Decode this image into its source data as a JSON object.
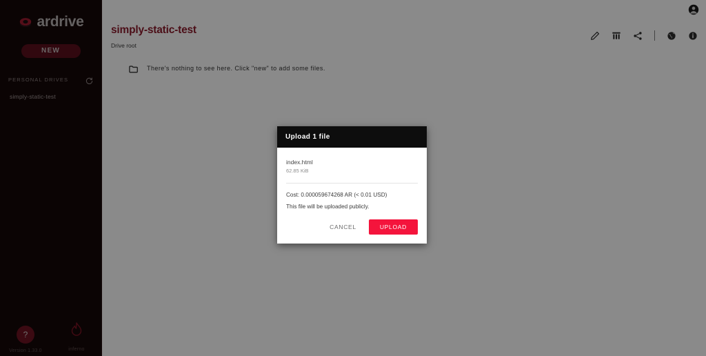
{
  "sidebar": {
    "logo_text": "ardrive",
    "new_button": "NEW",
    "drives_section_label": "PERSONAL DRIVES",
    "drives": [
      {
        "name": "simply-static-test"
      }
    ],
    "footer": {
      "help_glyph": "?",
      "version": "Version 1.33.0",
      "inferno_label": "inferno"
    }
  },
  "main": {
    "page_title": "simply-static-test",
    "breadcrumb": "Drive root",
    "empty_message": "There's nothing to see here. Click \"new\" to add some files.",
    "toolbar_icons": [
      {
        "name": "edit-icon"
      },
      {
        "name": "table-icon"
      },
      {
        "name": "share-icon"
      },
      {
        "name": "globe-icon"
      },
      {
        "name": "info-icon"
      }
    ]
  },
  "modal": {
    "title": "Upload 1 file",
    "file": {
      "name": "index.html",
      "size": "62.85 KiB"
    },
    "cost": "Cost: 0.000059674268 AR (< 0.01 USD)",
    "privacy_note": "This file will be uploaded publicly.",
    "cancel_label": "CANCEL",
    "upload_label": "UPLOAD"
  },
  "colors": {
    "brand_red": "#f4143c",
    "title_red": "#8c1c2d",
    "sidebar_bg": "#150808",
    "modal_header_bg": "#0d0d0d"
  }
}
